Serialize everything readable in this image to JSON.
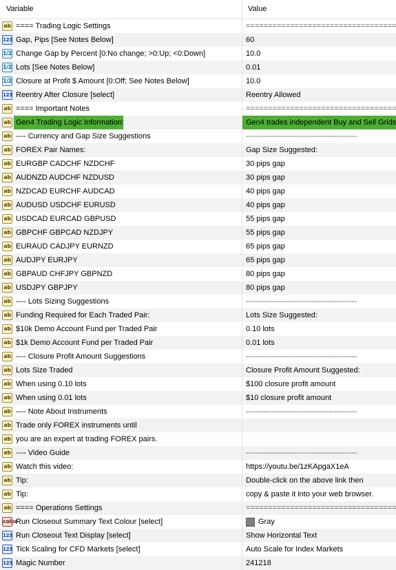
{
  "header": {
    "variable": "Variable",
    "value": "Value"
  },
  "icons": {
    "ab": "ab",
    "num": "123",
    "flt": "1/2",
    "col": "color"
  },
  "rows": [
    {
      "type": "ab",
      "name": "==== Trading Logic Settings",
      "value": "========================================"
    },
    {
      "type": "num",
      "name": "Gap, Pips [See Notes Below]",
      "value": "60"
    },
    {
      "type": "flt",
      "name": "Change Gap by Percent [0:No change; >0:Up; <0:Down]",
      "value": "10.0"
    },
    {
      "type": "flt",
      "name": "Lots [See Notes Below]",
      "value": "0.01"
    },
    {
      "type": "flt",
      "name": "Closure at Profit $ Amount [0:Off; See Notes Below]",
      "value": "10.0"
    },
    {
      "type": "num",
      "name": "Reentry After Closure [select]",
      "value": "Reentry Allowed"
    },
    {
      "type": "ab",
      "name": "==== Important Notes",
      "value": "========================================"
    },
    {
      "type": "ab",
      "name": "Gen4 Trading Logic Information:",
      "value": "Gen4 trades independent Buy and Sell Grids",
      "highlight": true
    },
    {
      "type": "ab",
      "name": "---- Currency and Gap Size Suggestions",
      "value": "--------------------------------------------"
    },
    {
      "type": "ab",
      "name": "FOREX Pair Names:",
      "value": "Gap Size Suggested:"
    },
    {
      "type": "ab",
      "name": "EURGBP CADCHF NZDCHF",
      "value": "30 pips gap"
    },
    {
      "type": "ab",
      "name": "AUDNZD AUDCHF NZDUSD",
      "value": "30 pips gap"
    },
    {
      "type": "ab",
      "name": "NZDCAD EURCHF AUDCAD",
      "value": "40 pips gap"
    },
    {
      "type": "ab",
      "name": "AUDUSD USDCHF EURUSD",
      "value": "40 pips gap"
    },
    {
      "type": "ab",
      "name": "USDCAD EURCAD GBPUSD",
      "value": "55 pips gap"
    },
    {
      "type": "ab",
      "name": "GBPCHF GBPCAD NZDJPY",
      "value": "55 pips gap"
    },
    {
      "type": "ab",
      "name": "EURAUD CADJPY EURNZD",
      "value": "65 pips gap"
    },
    {
      "type": "ab",
      "name": "AUDJPY EURJPY",
      "value": "65 pips gap"
    },
    {
      "type": "ab",
      "name": "GBPAUD CHFJPY GBPNZD",
      "value": "80 pips gap"
    },
    {
      "type": "ab",
      "name": "USDJPY GBPJPY",
      "value": "80 pips gap"
    },
    {
      "type": "ab",
      "name": "---- Lots Sizing Suggestions",
      "value": "--------------------------------------------"
    },
    {
      "type": "ab",
      "name": "Funding Required for Each Traded Pair:",
      "value": "Lots Size Suggested:"
    },
    {
      "type": "ab",
      "name": "$10k Demo Account Fund per Traded Pair",
      "value": "0.10 lots"
    },
    {
      "type": "ab",
      "name": "$1k Demo Account Fund per Traded Pair",
      "value": "0.01 lots"
    },
    {
      "type": "ab",
      "name": "---- Closure Profit Amount Suggestions",
      "value": "--------------------------------------------"
    },
    {
      "type": "ab",
      "name": "Lots Size Traded",
      "value": "Closure Profit Amount Suggested:"
    },
    {
      "type": "ab",
      "name": "When using 0.10 lots",
      "value": "$100 closure profit amount"
    },
    {
      "type": "ab",
      "name": "When using 0.01 lots",
      "value": "$10 closure profit amount"
    },
    {
      "type": "ab",
      "name": "---- Note About Instruments",
      "value": "--------------------------------------------"
    },
    {
      "type": "ab",
      "name": "Trade only FOREX instruments until",
      "value": ""
    },
    {
      "type": "ab",
      "name": "you are an expert at trading FOREX pairs.",
      "value": ""
    },
    {
      "type": "ab",
      "name": "---- Video Guide",
      "value": "--------------------------------------------"
    },
    {
      "type": "ab",
      "name": "Watch this video:",
      "value": "https://youtu.be/1zKApgaX1eA"
    },
    {
      "type": "ab",
      "name": "Tip:",
      "value": "Double-click on the above link then"
    },
    {
      "type": "ab",
      "name": "Tip:",
      "value": "copy & paste it into your web browser."
    },
    {
      "type": "ab",
      "name": "==== Operations Settings",
      "value": "========================================"
    },
    {
      "type": "col",
      "name": "Run Closeout Summary Text Colour [select]",
      "value": "Gray",
      "swatch": "#808080"
    },
    {
      "type": "num",
      "name": "Run Closeout Text Display [select]",
      "value": "Show Horizontal Text"
    },
    {
      "type": "num",
      "name": "Tick Scaling for CFD Markets [select]",
      "value": "Auto Scale for Index Markets"
    },
    {
      "type": "num",
      "name": "Magic Number",
      "value": "241218"
    }
  ]
}
